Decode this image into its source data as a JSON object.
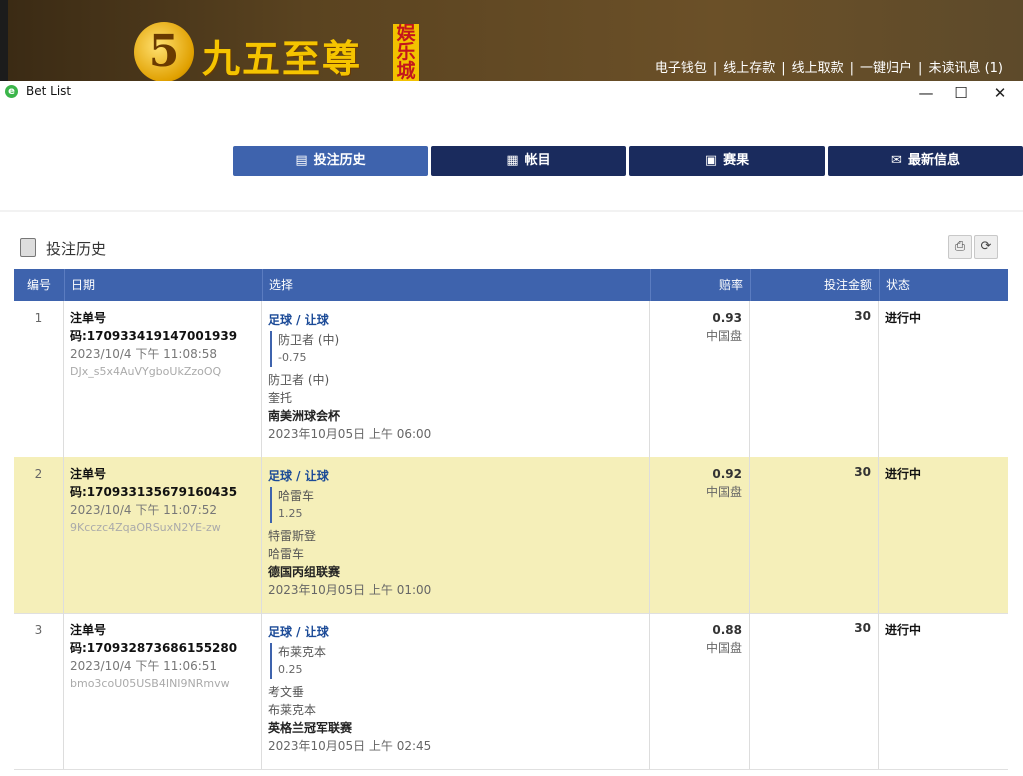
{
  "banner": {
    "logo_badge": "5",
    "logo_text": "九五至尊",
    "logo_tag": "娱乐城",
    "nav": [
      "电子钱包",
      "线上存款",
      "线上取款",
      "一键归户",
      "未读讯息 (1)"
    ],
    "nav_separator": "|"
  },
  "window": {
    "title": "Bet List",
    "controls": {
      "minimize": "—",
      "maximize": "☐",
      "close": "✕"
    }
  },
  "tabs": [
    {
      "label": "投注历史",
      "icon": "clipboard-icon",
      "active": true
    },
    {
      "label": "帐目",
      "icon": "ledger-icon",
      "active": false
    },
    {
      "label": "赛果",
      "icon": "results-icon",
      "active": false
    },
    {
      "label": "最新信息",
      "icon": "envelope-icon",
      "active": false
    }
  ],
  "section": {
    "title": "投注历史"
  },
  "table": {
    "headers": [
      "编号",
      "日期",
      "选择",
      "赔率",
      "投注金额",
      "状态"
    ],
    "rows": [
      {
        "num": "1",
        "bet_id": "注单号码:170933419147001939",
        "time": "2023/10/4 下午 11:08:58",
        "hash": "DJx_s5x4AuVYgboUkZzoOQ",
        "sport": "足球 / 让球",
        "pick": "防卫者 (中)",
        "handicap": "-0.75",
        "home": "防卫者 (中)",
        "away": "奎托",
        "league": "南美洲球会杯",
        "match_date": "2023年10月05日 上午 06:00",
        "odds": "0.93",
        "market": "中国盘",
        "stake": "30",
        "status": "进行中"
      },
      {
        "num": "2",
        "bet_id": "注单号码:170933135679160435",
        "time": "2023/10/4 下午 11:07:52",
        "hash": "9Kcczc4ZqaORSuxN2YE-zw",
        "sport": "足球 / 让球",
        "pick": "哈雷车",
        "handicap": "1.25",
        "home": "特雷斯登",
        "away": "哈雷车",
        "league": "德国丙组联赛",
        "match_date": "2023年10月05日 上午 01:00",
        "odds": "0.92",
        "market": "中国盘",
        "stake": "30",
        "status": "进行中"
      },
      {
        "num": "3",
        "bet_id": "注单号码:170932873686155280",
        "time": "2023/10/4 下午 11:06:51",
        "hash": "bmo3coU05USB4INI9NRmvw",
        "sport": "足球 / 让球",
        "pick": "布莱克本",
        "handicap": "0.25",
        "home": "考文垂",
        "away": "布莱克本",
        "league": "英格兰冠军联赛",
        "match_date": "2023年10月05日 上午 02:45",
        "odds": "0.88",
        "market": "中国盘",
        "stake": "30",
        "status": "进行中"
      }
    ]
  },
  "colors": {
    "header_blue": "#3e63ad",
    "tab_dark": "#1a2b5d",
    "alt_row": "#f5efb9",
    "logo_gold": "#f5c400"
  }
}
